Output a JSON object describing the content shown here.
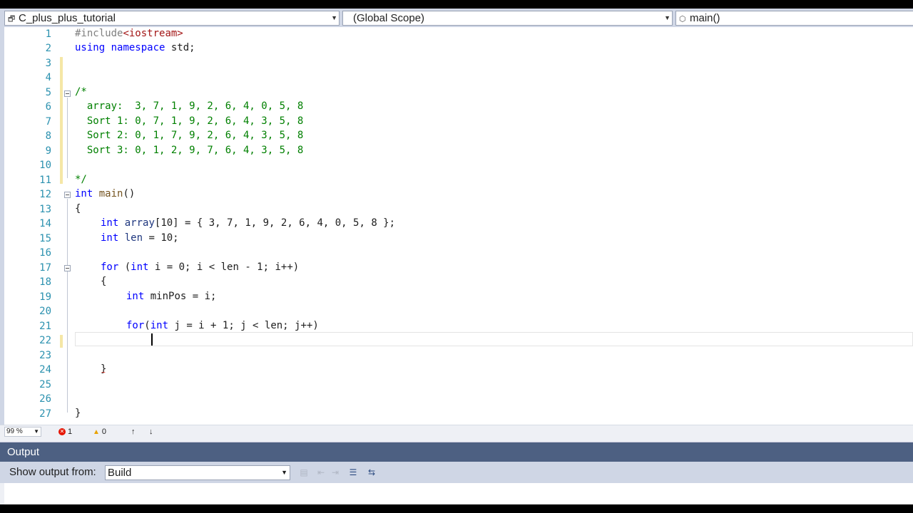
{
  "nav": {
    "project": "C_plus_plus_tutorial",
    "scope": "(Global Scope)",
    "function": "main()"
  },
  "editor": {
    "line_numbers": [
      "1",
      "2",
      "3",
      "4",
      "5",
      "6",
      "7",
      "8",
      "9",
      "10",
      "11",
      "12",
      "13",
      "14",
      "15",
      "16",
      "17",
      "18",
      "19",
      "20",
      "21",
      "22",
      "23",
      "24",
      "25",
      "26",
      "27"
    ],
    "lines": {
      "l1_directive": "#include",
      "l1_header": "<iostream>",
      "l2_kw1": "using",
      "l2_kw2": "namespace",
      "l2_rest": " std;",
      "l5": "/*",
      "l6": "  array:  3, 7, 1, 9, 2, 6, 4, 0, 5, 8",
      "l7": "  Sort 1: 0, 7, 1, 9, 2, 6, 4, 3, 5, 8",
      "l8": "  Sort 2: 0, 1, 7, 9, 2, 6, 4, 3, 5, 8",
      "l9": "  Sort 3: 0, 1, 2, 9, 7, 6, 4, 3, 5, 8",
      "l11": "*/",
      "l12_kw": "int",
      "l12_fn": "main",
      "l12_rest": "()",
      "l13": "{",
      "l14_kw": "int",
      "l14_var": "array",
      "l14_rest": "[10] = { 3, 7, 1, 9, 2, 6, 4, 0, 5, 8 };",
      "l15_kw": "int",
      "l15_var": "len",
      "l15_rest": " = 10;",
      "l17_kw1": "for",
      "l17_kw2": "int",
      "l17_rest": " i = 0; i < len - 1; i++)",
      "l18": "{",
      "l19_kw": "int",
      "l19_rest": " minPos = i;",
      "l21_kw1": "for",
      "l21_kw2": "int",
      "l21_rest": " j = i + 1; j < len; j++)",
      "l24": "}",
      "l27": "}"
    }
  },
  "status": {
    "zoom": "99 %",
    "errors": "1",
    "warnings": "0"
  },
  "output": {
    "title": "Output",
    "show_label": "Show output from:",
    "source": "Build"
  },
  "colors": {
    "keyword": "#0000ff",
    "comment": "#008000",
    "line_number": "#2b91af",
    "output_header": "#4d6082"
  }
}
